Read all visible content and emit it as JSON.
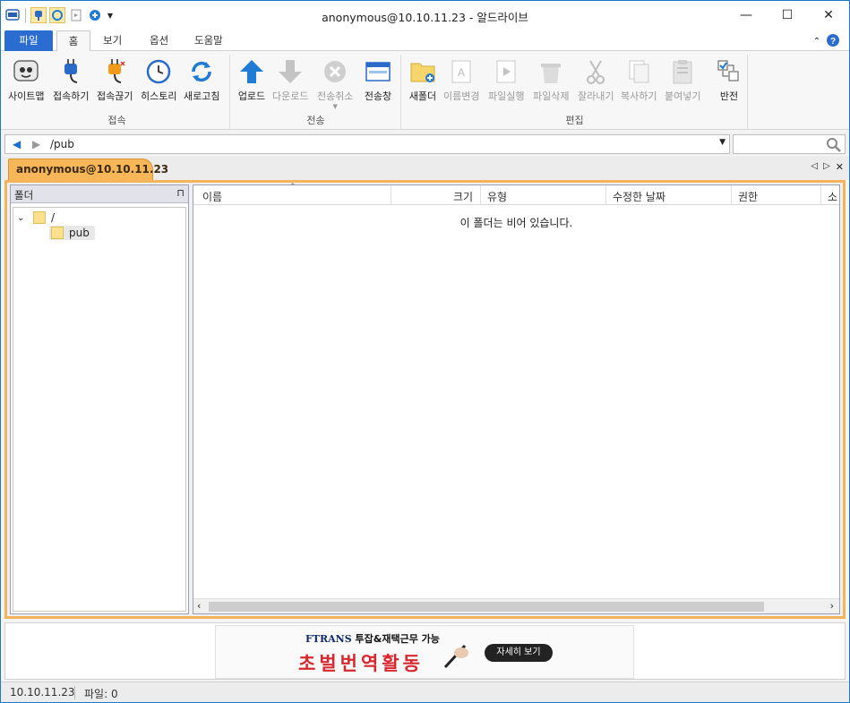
{
  "window": {
    "title": "anonymous@10.10.11.23 - 알드라이브",
    "minimize": "—",
    "maximize": "☐",
    "close": "✕"
  },
  "ribbon_tabs": [
    "파일",
    "홈",
    "보기",
    "옵션",
    "도움말"
  ],
  "groups": {
    "connect": {
      "label": "접속",
      "buttons": [
        "사이트맵",
        "접속하기",
        "접속끊기",
        "히스토리",
        "새로고침"
      ]
    },
    "transfer": {
      "label": "전송",
      "buttons": [
        "업로드",
        "다운로드",
        "전송취소",
        "전송창"
      ]
    },
    "edit": {
      "label": "편집",
      "buttons": [
        "새폴더",
        "이름변경",
        "파일실행",
        "파일삭제",
        "잘라내기",
        "복사하기",
        "붙여넣기",
        "반전"
      ]
    }
  },
  "address": {
    "path": "/pub",
    "search_placeholder": ""
  },
  "session_tab": "anonymous@10.10.11.23",
  "folder_pane": {
    "title": "폴더",
    "tree": [
      "/",
      "pub"
    ]
  },
  "list": {
    "columns": [
      "이름",
      "크기",
      "유형",
      "수정한 날짜",
      "권한",
      "소"
    ],
    "empty_message": "이 폴더는 비어 있습니다."
  },
  "ad": {
    "brand": "FTRANS",
    "top_text": "투잡&재택근무 가능",
    "main_text": "초벌번역활동",
    "button": "자세히 보기"
  },
  "status": {
    "host": "10.10.11.23",
    "files": "파일: 0"
  },
  "colors": {
    "accent": "#2b6cd1",
    "session_tab": "#f7b759",
    "frame_border": "#f3b45c",
    "ad_red": "#d7282f"
  }
}
